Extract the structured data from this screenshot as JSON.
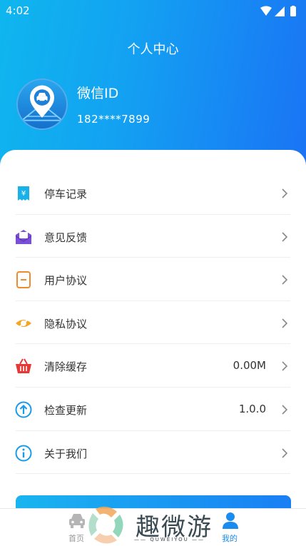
{
  "status_bar": {
    "time": "4:02"
  },
  "header": {
    "title": "个人中心"
  },
  "user": {
    "name": "微信ID",
    "phone": "182****7899",
    "avatar_icon": "car-location-pin-icon"
  },
  "menu": {
    "items": [
      {
        "label": "停车记录",
        "value": "",
        "icon": "receipt-icon",
        "icon_color": "#1ab0e8"
      },
      {
        "label": "意见反馈",
        "value": "",
        "icon": "envelope-icon",
        "icon_color": "#7a4fd6"
      },
      {
        "label": "用户协议",
        "value": "",
        "icon": "document-icon",
        "icon_color": "#f08a2a"
      },
      {
        "label": "隐私协议",
        "value": "",
        "icon": "eye-slash-icon",
        "icon_color": "#f5a623"
      },
      {
        "label": "清除缓存",
        "value": "0.00M",
        "icon": "basket-icon",
        "icon_color": "#e53935"
      },
      {
        "label": "检查更新",
        "value": "1.0.0",
        "icon": "arrow-up-circle-icon",
        "icon_color": "#1a9be8"
      },
      {
        "label": "关于我们",
        "value": "",
        "icon": "info-circle-icon",
        "icon_color": "#1a9be8"
      }
    ]
  },
  "tabbar": {
    "home_label": "首页",
    "mine_label": "我的"
  },
  "watermark": {
    "text": "趣微游",
    "sub": "—— QUWEIYOU ——"
  },
  "colors": {
    "accent": "#1a8cf0",
    "header_start": "#0fb6ee",
    "header_end": "#1a73f5"
  }
}
